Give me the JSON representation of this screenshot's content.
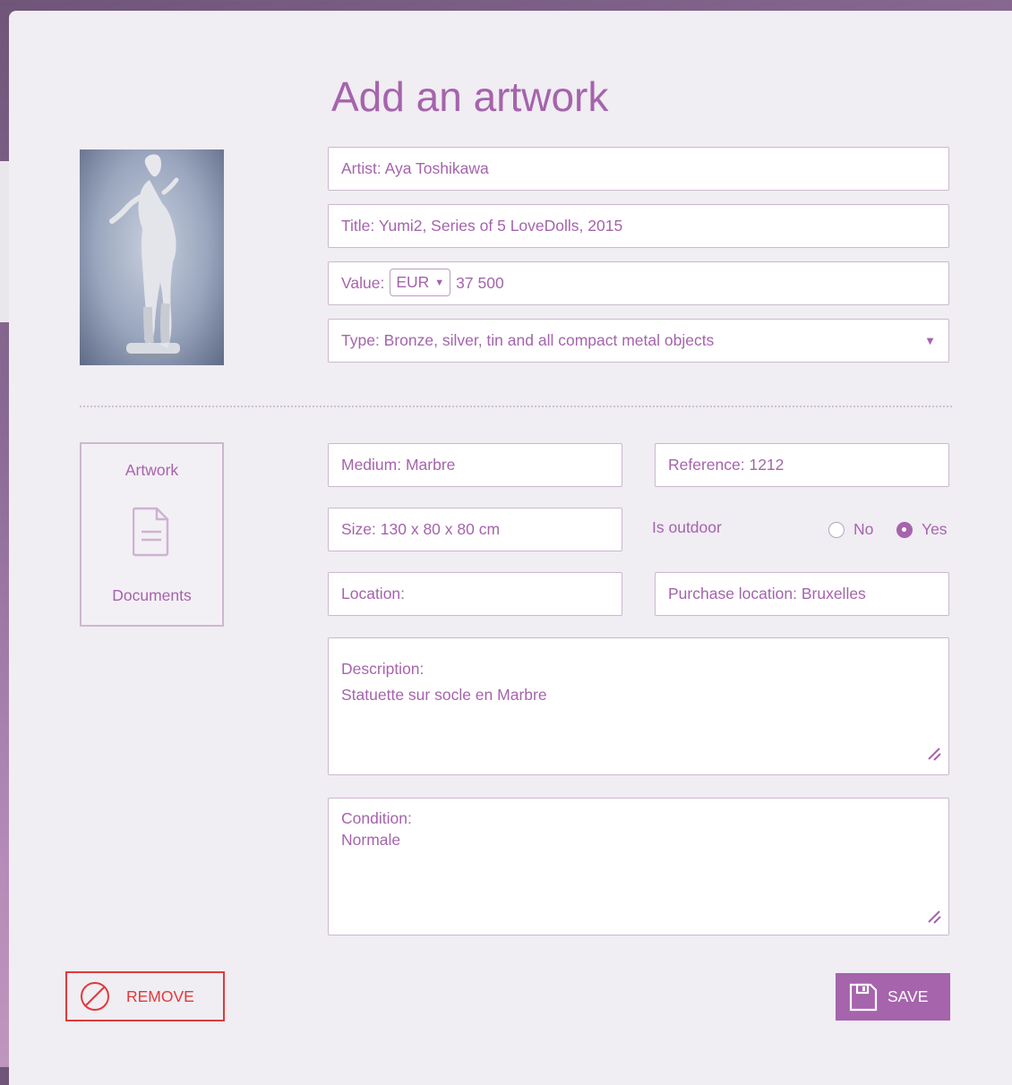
{
  "page": {
    "title": "Add an artwork"
  },
  "artwork": {
    "artist": "Artist: Aya Toshikawa",
    "title": "Title: Yumi2, Series of 5 LoveDolls, 2015",
    "value_label": "Value:",
    "currency": "EUR",
    "value": "37 500",
    "type": "Type: Bronze, silver, tin and all compact metal objects"
  },
  "docs": {
    "top_label": "Artwork",
    "bottom_label": "Documents",
    "icon": "document-icon"
  },
  "details": {
    "medium": "Medium: Marbre",
    "reference": "Reference: 1212",
    "size": "Size: 130 x 80 x 80 cm",
    "outdoor_label": "Is outdoor",
    "outdoor_options": [
      "No",
      "Yes"
    ],
    "outdoor_selected": "Yes",
    "location": "Location:",
    "purchase_location": "Purchase location: Bruxelles",
    "description_label": "Description:",
    "description": "Statuette sur socle en Marbre",
    "condition_label": "Condition:",
    "condition": "Normale"
  },
  "actions": {
    "remove_label": "REMOVE",
    "save_label": "SAVE"
  },
  "colors": {
    "accent": "#a564ac",
    "danger": "#e03a3a",
    "border": "#cdb7cf",
    "panel": "#f0edf3"
  }
}
